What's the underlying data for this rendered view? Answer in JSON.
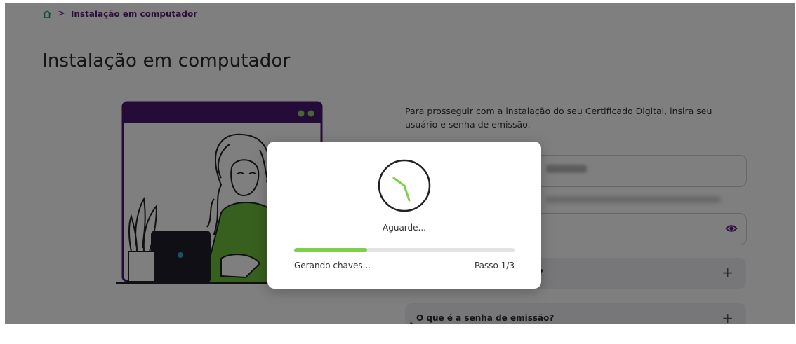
{
  "breadcrumb": {
    "home_icon": "home-icon",
    "separator": ">",
    "current": "Instalação em computador"
  },
  "page": {
    "title": "Instalação em computador"
  },
  "form": {
    "intro": "Para prosseguir com a instalação do seu Certificado Digital, insira seu usuário e senha de emissão.",
    "password_icon": "eye-icon"
  },
  "faq": [
    {
      "question": "?",
      "icon": "plus-icon",
      "symbol": "+"
    },
    {
      "question": "O que é a senha de emissão?",
      "icon": "plus-icon",
      "symbol": "+"
    }
  ],
  "modal": {
    "icon": "clock-icon",
    "message": "Aguarde...",
    "progress": 0.33,
    "status": "Gerando chaves...",
    "step": "Passo 1/3"
  },
  "colors": {
    "brand": "#5a1a80",
    "progress": "#7ed04b",
    "shirt": "#6fbf3a",
    "laptop": "#1f1f2b"
  }
}
